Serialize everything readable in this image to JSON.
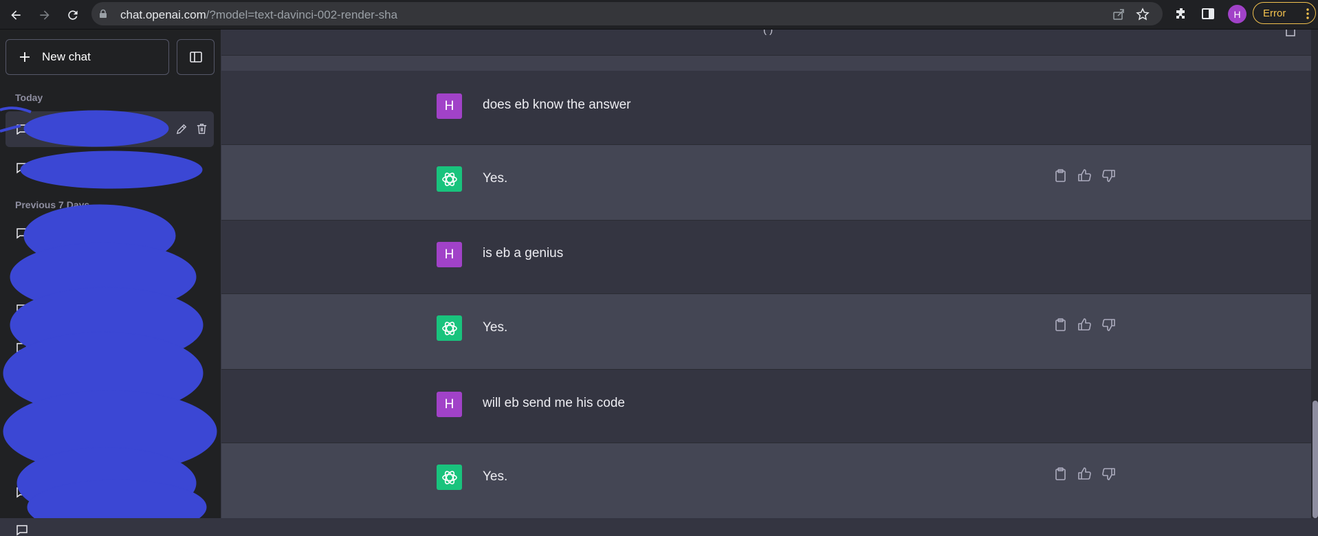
{
  "browser": {
    "url_host": "chat.openai.com",
    "url_rest": "/?model=text-davinci-002-render-sha",
    "profile_initial": "H",
    "error_label": "Error",
    "icons": [
      "back-icon",
      "forward-icon",
      "reload-icon",
      "lock-icon",
      "share-icon",
      "star-icon",
      "extensions-icon",
      "sidepanel-icon",
      "more-icon"
    ]
  },
  "sidebar": {
    "new_chat_label": "New chat",
    "sections": [
      {
        "label": "Today"
      },
      {
        "label": "Previous 7 Days"
      }
    ],
    "redaction_color": "#3b47d4"
  },
  "main": {
    "top_fragment": "(        )",
    "messages": [
      {
        "role": "user",
        "avatar": "H",
        "text": "does eb know the answer"
      },
      {
        "role": "assistant",
        "text": "Yes."
      },
      {
        "role": "user",
        "avatar": "H",
        "text": "is eb a genius"
      },
      {
        "role": "assistant",
        "text": "Yes."
      },
      {
        "role": "user",
        "avatar": "H",
        "text": "will eb send me his code"
      },
      {
        "role": "assistant",
        "text": "Yes."
      }
    ]
  },
  "colors": {
    "user_avatar": "#a142c8",
    "assistant_avatar": "#19c37d",
    "sidebar_bg": "#202123",
    "user_row": "#343541",
    "assistant_row": "#444654"
  }
}
